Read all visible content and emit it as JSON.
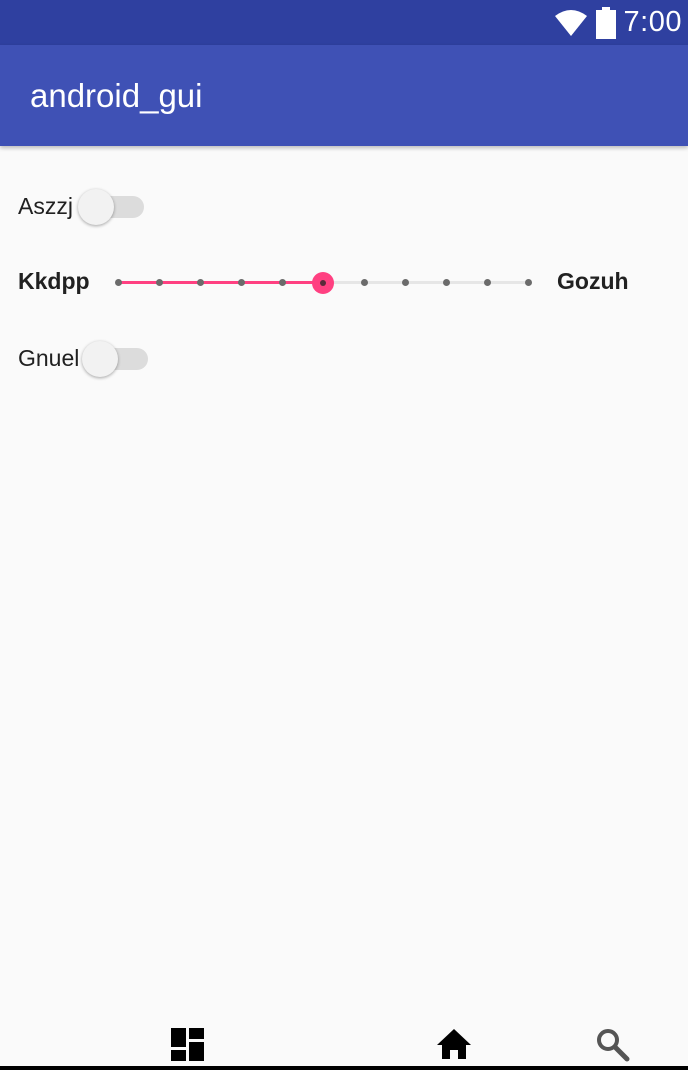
{
  "status_bar": {
    "time": "7:00",
    "icons": [
      "wifi-icon",
      "battery-icon"
    ],
    "color": "#2f40a0"
  },
  "app_bar": {
    "title": "android_gui",
    "color": "#3f51b5"
  },
  "controls": {
    "switch1": {
      "label": "Aszzj",
      "checked": false
    },
    "seekbar": {
      "min_label": "Kkdpp",
      "max_label": "Gozuh",
      "steps": 10,
      "value": 5,
      "accent": "#ff4081"
    },
    "switch2": {
      "label": "Gnuel",
      "checked": false
    }
  },
  "bottom_nav": {
    "items": [
      "dashboard-icon",
      "home-icon",
      "search-icon"
    ]
  }
}
